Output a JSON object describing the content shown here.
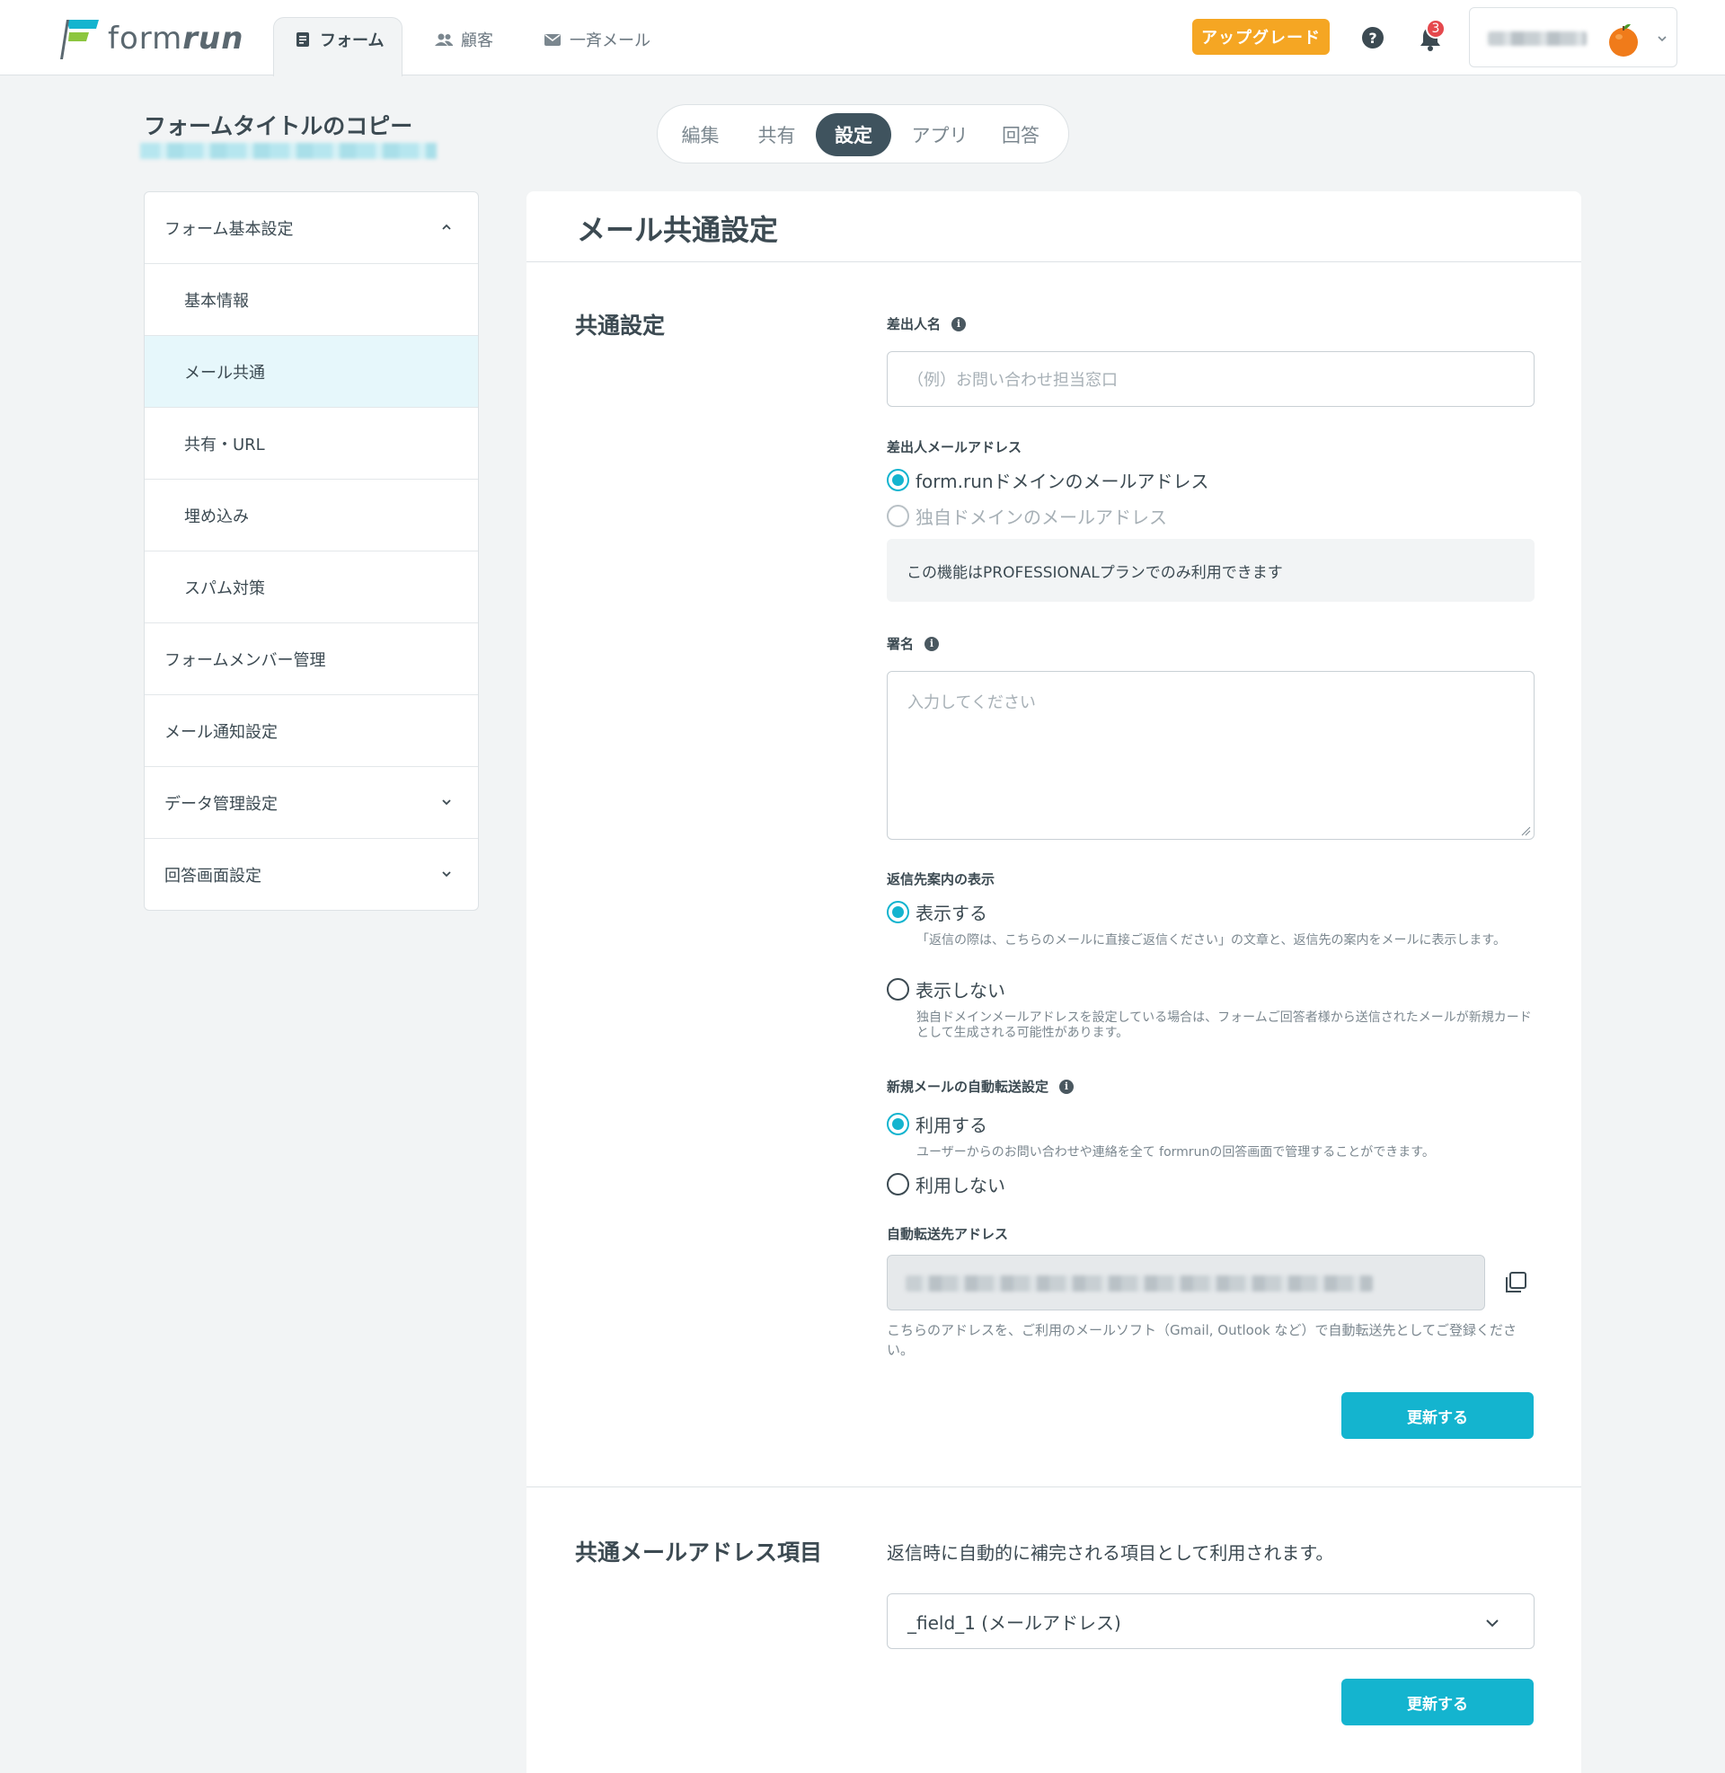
{
  "header": {
    "logo_text": "form",
    "logo_text_bold": "run",
    "nav": [
      {
        "label": "フォーム",
        "icon": "form-icon",
        "active": true
      },
      {
        "label": "顧客",
        "icon": "users-icon",
        "active": false
      },
      {
        "label": "一斉メール",
        "icon": "mail-icon",
        "active": false
      }
    ],
    "upgrade_label": "アップグレード",
    "help_label": "?",
    "notification_count": "3"
  },
  "form": {
    "title": "フォームタイトルのコピー",
    "tabs": [
      "編集",
      "共有",
      "設定",
      "アプリ",
      "回答"
    ],
    "active_tab": "設定"
  },
  "sidebar": {
    "items": [
      {
        "label": "フォーム基本設定",
        "level": "top",
        "chevron": "up"
      },
      {
        "label": "基本情報",
        "level": "sub"
      },
      {
        "label": "メール共通",
        "level": "sub",
        "selected": true
      },
      {
        "label": "共有・URL",
        "level": "sub"
      },
      {
        "label": "埋め込み",
        "level": "sub"
      },
      {
        "label": "スパム対策",
        "level": "sub"
      },
      {
        "label": "フォームメンバー管理",
        "level": "top"
      },
      {
        "label": "メール通知設定",
        "level": "top"
      },
      {
        "label": "データ管理設定",
        "level": "top",
        "chevron": "down"
      },
      {
        "label": "回答画面設定",
        "level": "top",
        "chevron": "down"
      }
    ]
  },
  "main": {
    "title": "メール共通設定",
    "common": {
      "section_title": "共通設定",
      "sender_name_label": "差出人名",
      "sender_name_placeholder": "（例）お問い合わせ担当窓口",
      "sender_email_label": "差出人メールアドレス",
      "sender_email_options": [
        {
          "label": "form.runドメインのメールアドレス",
          "checked": true,
          "disabled": false
        },
        {
          "label": "独自ドメインのメールアドレス",
          "checked": false,
          "disabled": true
        }
      ],
      "professional_note": "この機能はPROFESSIONALプランでのみ利用できます",
      "signature_label": "署名",
      "signature_placeholder": "入力してください",
      "reply_label": "返信先案内の表示",
      "reply_options": [
        {
          "label": "表示する",
          "checked": true,
          "hint": "「返信の際は、こちらのメールに直接ご返信ください」の文章と、返信先の案内をメールに表示します。"
        },
        {
          "label": "表示しない",
          "checked": false,
          "hint": "独自ドメインメールアドレスを設定している場合は、フォームご回答者様から送信されたメールが新規カードとして生成される可能性があります。"
        }
      ],
      "forward_label": "新規メールの自動転送設定",
      "forward_options": [
        {
          "label": "利用する",
          "checked": true,
          "hint": "ユーザーからのお問い合わせや連絡を全て formrunの回答画面で管理することができます。"
        },
        {
          "label": "利用しない",
          "checked": false,
          "hint": ""
        }
      ],
      "forward_address_label": "自動転送先アドレス",
      "forward_address_hint": "こちらのアドレスを、ご利用のメールソフト（Gmail, Outlook など）で自動転送先としてご登録ください。",
      "update_label": "更新する"
    },
    "address_field": {
      "section_title": "共通メールアドレス項目",
      "description": "返信時に自動的に補完される項目として利用されます。",
      "selected": "_field_1 (メールアドレス)",
      "update_label": "更新する"
    }
  },
  "colors": {
    "accent": "#14b4cf",
    "upgrade": "#f5a623",
    "active_tab": "#3f535e",
    "badge": "#e5484d"
  }
}
